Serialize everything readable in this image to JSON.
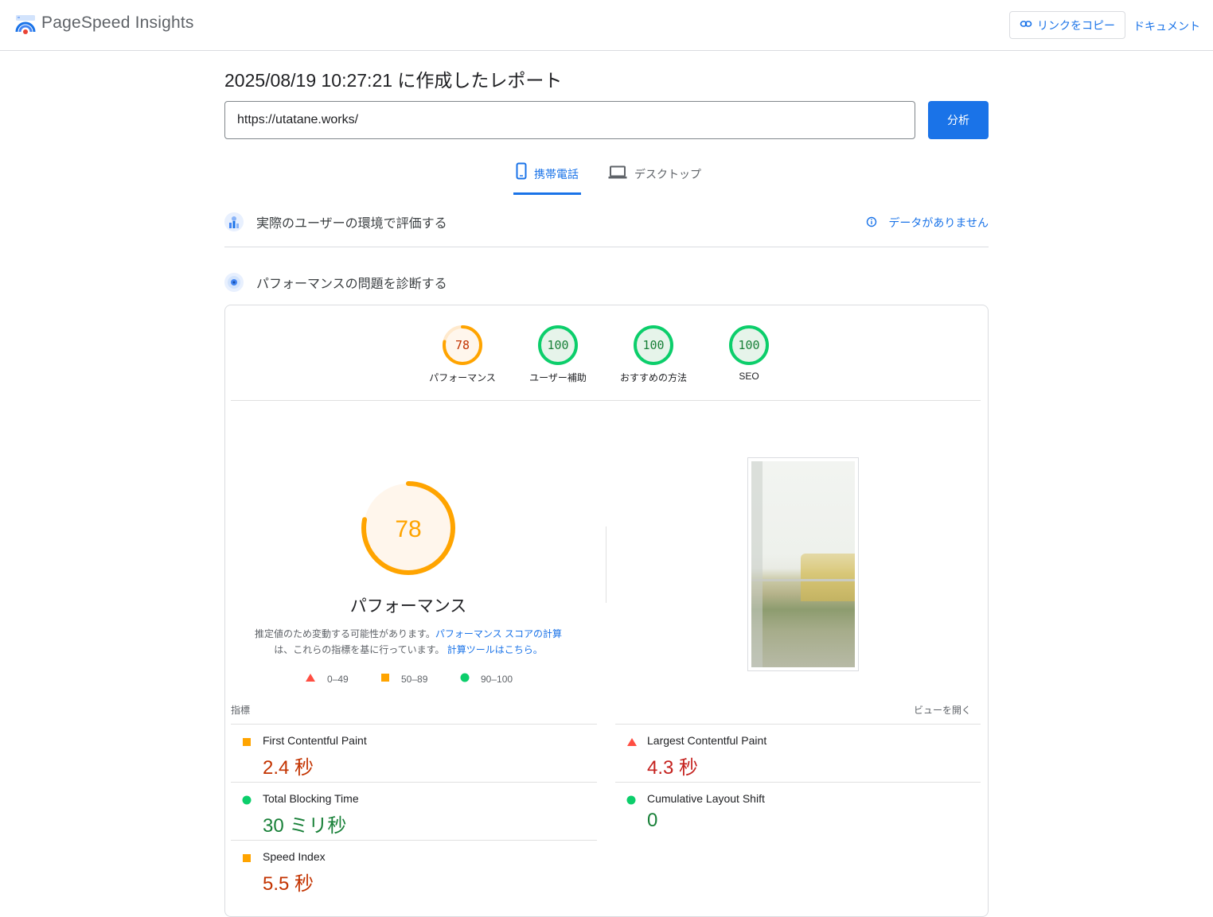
{
  "header": {
    "app_title": "PageSpeed Insights",
    "copy_link_label": "リンクをコピー",
    "docs_label": "ドキュメント"
  },
  "report": {
    "title": "2025/08/19 10:27:21 に作成したレポート",
    "url_value": "https://utatane.works/",
    "analyze_label": "分析"
  },
  "tabs": {
    "mobile_label": "携帯電話",
    "desktop_label": "デスクトップ",
    "active": "mobile"
  },
  "field_data": {
    "title": "実際のユーザーの環境で評価する",
    "status": "データがありません"
  },
  "diagnose": {
    "title": "パフォーマンスの問題を診断する"
  },
  "categories": [
    {
      "label": "パフォーマンス",
      "score": "78"
    },
    {
      "label": "ユーザー補助",
      "score": "100"
    },
    {
      "label": "おすすめの方法",
      "score": "100"
    },
    {
      "label": "SEO",
      "score": "100"
    }
  ],
  "performance": {
    "score": "78",
    "title": "パフォーマンス",
    "note_prefix": "推定値のため変動する可能性があります。",
    "note_link1": "パフォーマンス スコアの計算",
    "note_middle": "は、これらの指標を基に行っています。",
    "note_link2": "計算ツールはこちら。"
  },
  "legend": {
    "fail": "0–49",
    "average": "50–89",
    "pass": "90–100"
  },
  "metrics_section": {
    "heading": "指標",
    "expand_label": "ビューを開く"
  },
  "metrics": [
    {
      "name": "First Contentful Paint",
      "value": "2.4 秒",
      "rating": "average"
    },
    {
      "name": "Largest Contentful Paint",
      "value": "4.3 秒",
      "rating": "fail"
    },
    {
      "name": "Total Blocking Time",
      "value": "30 ミリ秒",
      "rating": "pass"
    },
    {
      "name": "Cumulative Layout Shift",
      "value": "0",
      "rating": "pass"
    },
    {
      "name": "Speed Index",
      "value": "5.5 秒",
      "rating": "average"
    }
  ],
  "colors": {
    "accent": "#1a73e8",
    "pass": "#0cce6b",
    "average": "#ffa400",
    "fail": "#ff4e42"
  }
}
